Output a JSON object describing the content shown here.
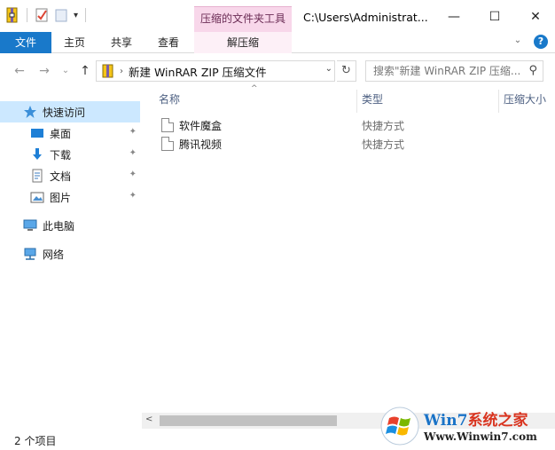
{
  "titlebar": {
    "context_tab_group": "压缩的文件夹工具",
    "path": "C:\\Users\\Administrat...",
    "minimize": "—",
    "maximize": "☐",
    "close": "✕"
  },
  "ribbon": {
    "tabs": [
      {
        "label": "文件"
      },
      {
        "label": "主页"
      },
      {
        "label": "共享"
      },
      {
        "label": "查看"
      },
      {
        "label": "解压缩"
      }
    ],
    "expand": "⌄",
    "help": "?"
  },
  "address": {
    "back": "←",
    "forward": "→",
    "recent": "⌄",
    "up": "↑",
    "crumb_sep": "›",
    "path": "新建 WinRAR ZIP 压缩文件",
    "dropdown": "⌄",
    "refresh": "↻",
    "search_placeholder": "搜索\"新建 WinRAR ZIP 压缩...",
    "search_icon": "⚲"
  },
  "sidebar": {
    "items": [
      {
        "label": "快速访问",
        "icon": "star-icon"
      },
      {
        "label": "桌面",
        "icon": "desktop-icon",
        "pinned": true
      },
      {
        "label": "下载",
        "icon": "download-icon",
        "pinned": true
      },
      {
        "label": "文档",
        "icon": "document-icon",
        "pinned": true
      },
      {
        "label": "图片",
        "icon": "picture-icon",
        "pinned": true
      },
      {
        "label": "此电脑",
        "icon": "computer-icon"
      },
      {
        "label": "网络",
        "icon": "network-icon"
      }
    ],
    "pin_glyph": "📌"
  },
  "columns": {
    "name": "名称",
    "type": "类型",
    "size": "压缩大小",
    "sort_glyph": "^"
  },
  "files": [
    {
      "name": "软件魔盒",
      "type": "快捷方式"
    },
    {
      "name": "腾讯视频",
      "type": "快捷方式"
    }
  ],
  "scrollbar": {
    "left_arrow": "<"
  },
  "status": {
    "count": "2 个项目"
  },
  "watermark": {
    "brand_prefix": "Win7",
    "brand_suffix": "系统之家",
    "url": "Www.Winwin7.com"
  },
  "colors": {
    "accent": "#1979ca",
    "context_tab": "#f8d7ea",
    "selection": "#cce8ff"
  }
}
